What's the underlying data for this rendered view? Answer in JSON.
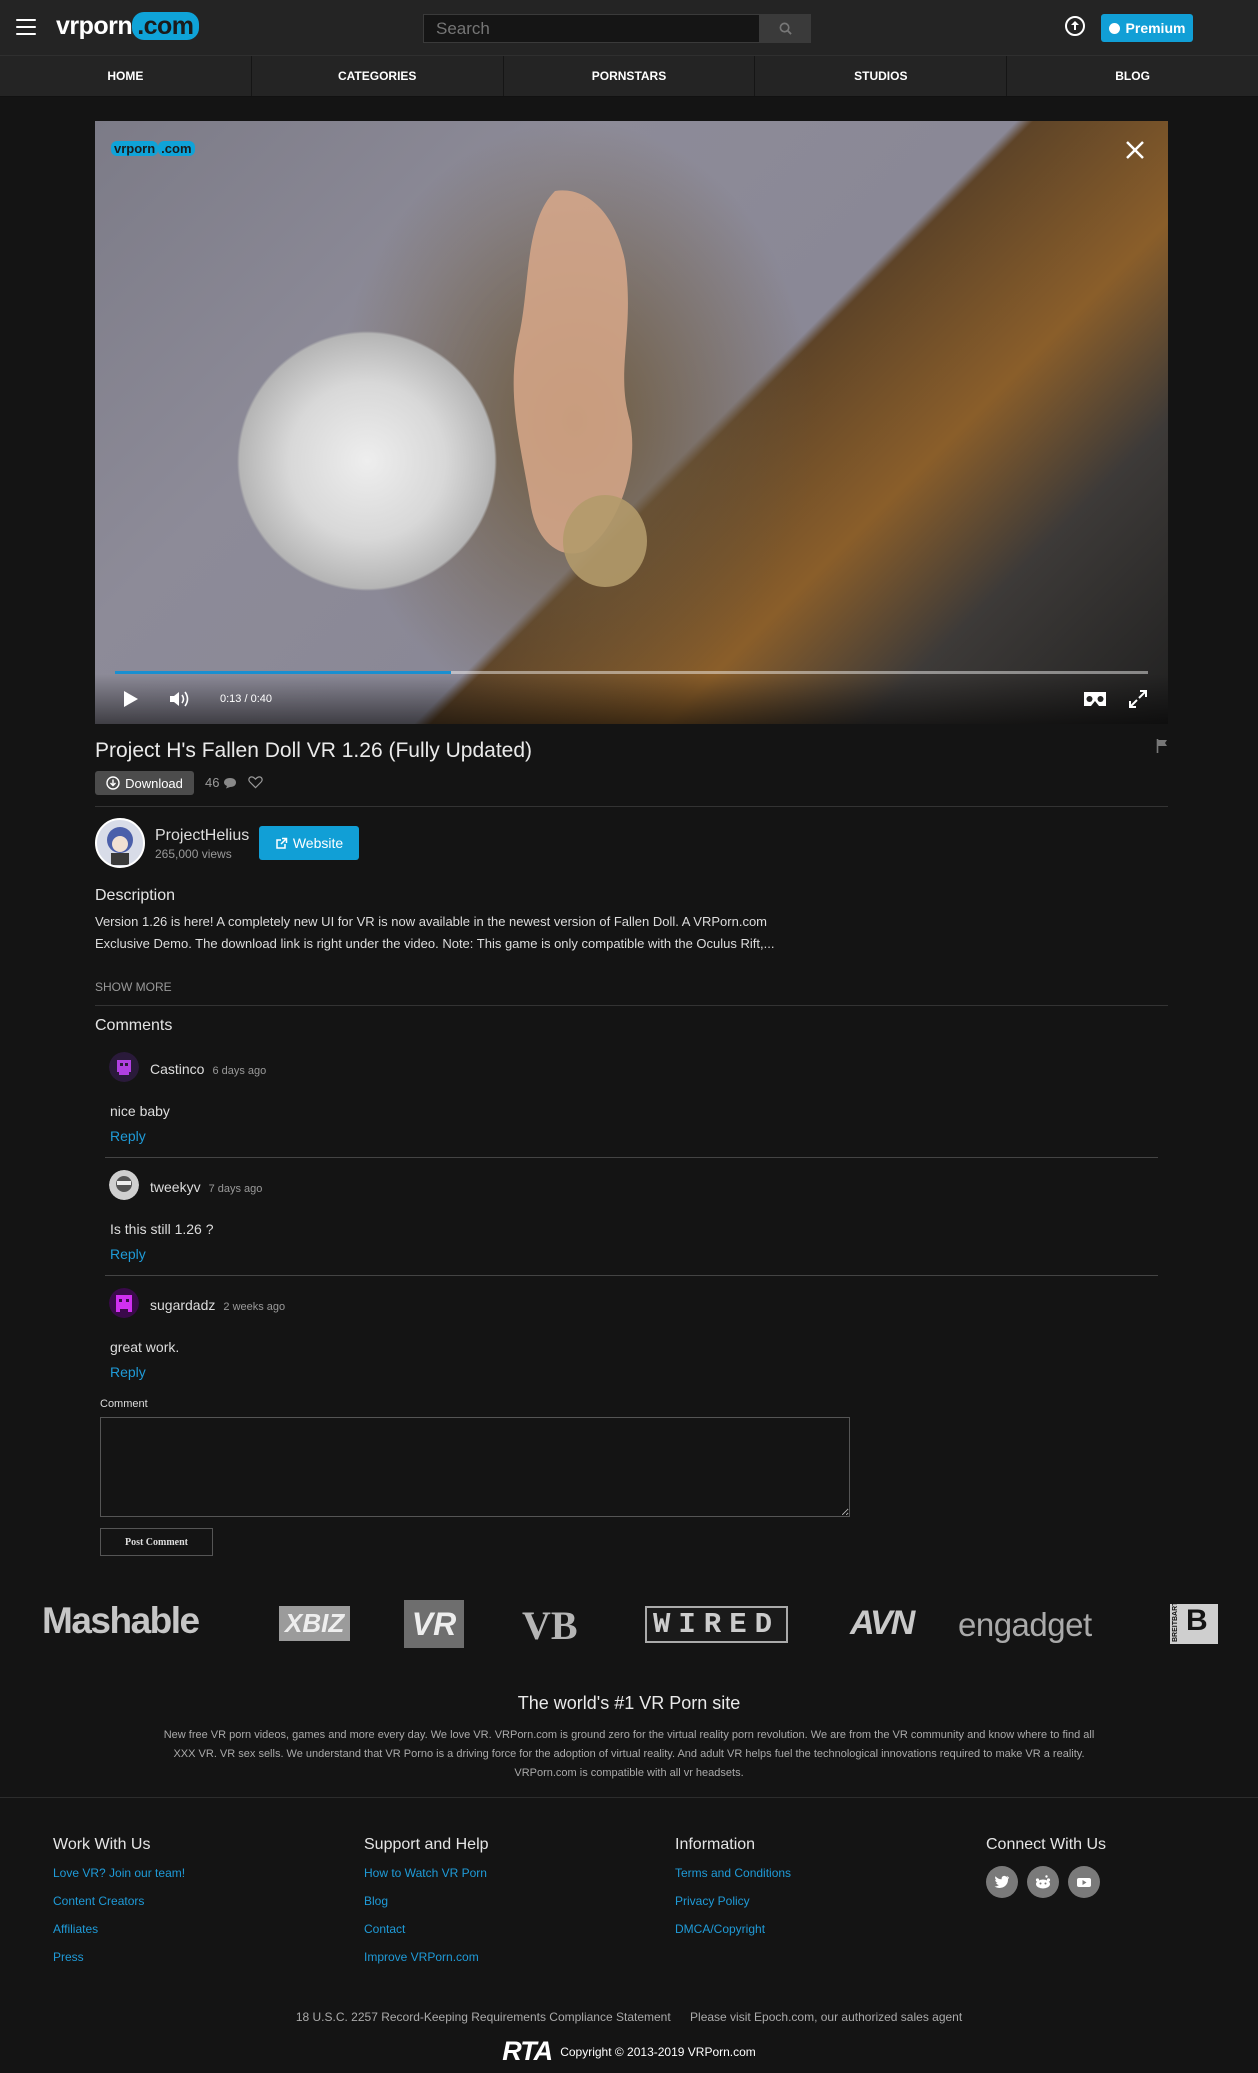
{
  "header": {
    "logo_main": "vrporn",
    "logo_dot": ".com",
    "search_placeholder": "Search",
    "premium_label": "Premium"
  },
  "nav": [
    "HOME",
    "CATEGORIES",
    "PORNSTARS",
    "STUDIOS",
    "BLOG"
  ],
  "player": {
    "brand_main": "vrporn",
    "brand_dot": ".com",
    "time": "0:13 / 0:40",
    "progress_fraction": 0.325
  },
  "video": {
    "title": "Project H's Fallen Doll VR 1.26 (Fully Updated)",
    "download_label": "Download",
    "comment_count": "46"
  },
  "uploader": {
    "name": "ProjectHelius",
    "views": "265,000 views",
    "website_label": "Website"
  },
  "description": {
    "heading": "Description",
    "line1": "Version 1.26 is here! A completely new UI for VR is now available in the newest version of Fallen Doll. A VRPorn.com",
    "line2": "Exclusive Demo. The download link is right under the video. Note: This game is only compatible with the Oculus Rift,...",
    "show_more": "SHOW MORE"
  },
  "comments": {
    "heading": "Comments",
    "items": [
      {
        "user": "Castinco",
        "time": "6 days ago",
        "text": "nice baby",
        "reply": "Reply"
      },
      {
        "user": "tweekyv",
        "time": "7 days ago",
        "text": "Is this still 1.26 ?",
        "reply": "Reply"
      },
      {
        "user": "sugardadz",
        "time": "2 weeks ago",
        "text": "great work.",
        "reply": "Reply"
      }
    ],
    "form_label": "Comment",
    "post_button": "Post Comment"
  },
  "press": [
    "Mashable",
    "XBIZ",
    "VR",
    "VB",
    "WIRED",
    "AVN",
    "engadget",
    "BREITBART"
  ],
  "tagline": "The world's #1 VR Porn site",
  "about": "New free VR porn videos, games and more every day. We love VR. VRPorn.com is ground zero for the virtual reality porn revolution. We are from the VR community and know where to find all XXX VR. VR sex sells. We understand that VR Porno is a driving force for the adoption of virtual reality. And adult VR helps fuel the technological innovations required to make VR a reality. VRPorn.com is compatible with all vr headsets.",
  "footer": {
    "work": {
      "heading": "Work With Us",
      "links": [
        "Love VR? Join our team!",
        "Content Creators",
        "Affiliates",
        "Press"
      ]
    },
    "support": {
      "heading": "Support and Help",
      "links": [
        "How to Watch VR Porn",
        "Blog",
        "Contact",
        "Improve VRPorn.com"
      ]
    },
    "info": {
      "heading": "Information",
      "links": [
        "Terms and Conditions",
        "Privacy Policy",
        "DMCA/Copyright"
      ]
    },
    "connect": {
      "heading": "Connect With Us",
      "icons": [
        "twitter-icon",
        "reddit-icon",
        "youtube-icon"
      ]
    },
    "compliance": "18 U.S.C. 2257 Record-Keeping Requirements Compliance Statement",
    "epoch": "Please visit Epoch.com, our authorized sales agent",
    "rta": "RTA",
    "copyright": "Copyright © 2013-2019 VRPorn.com"
  }
}
